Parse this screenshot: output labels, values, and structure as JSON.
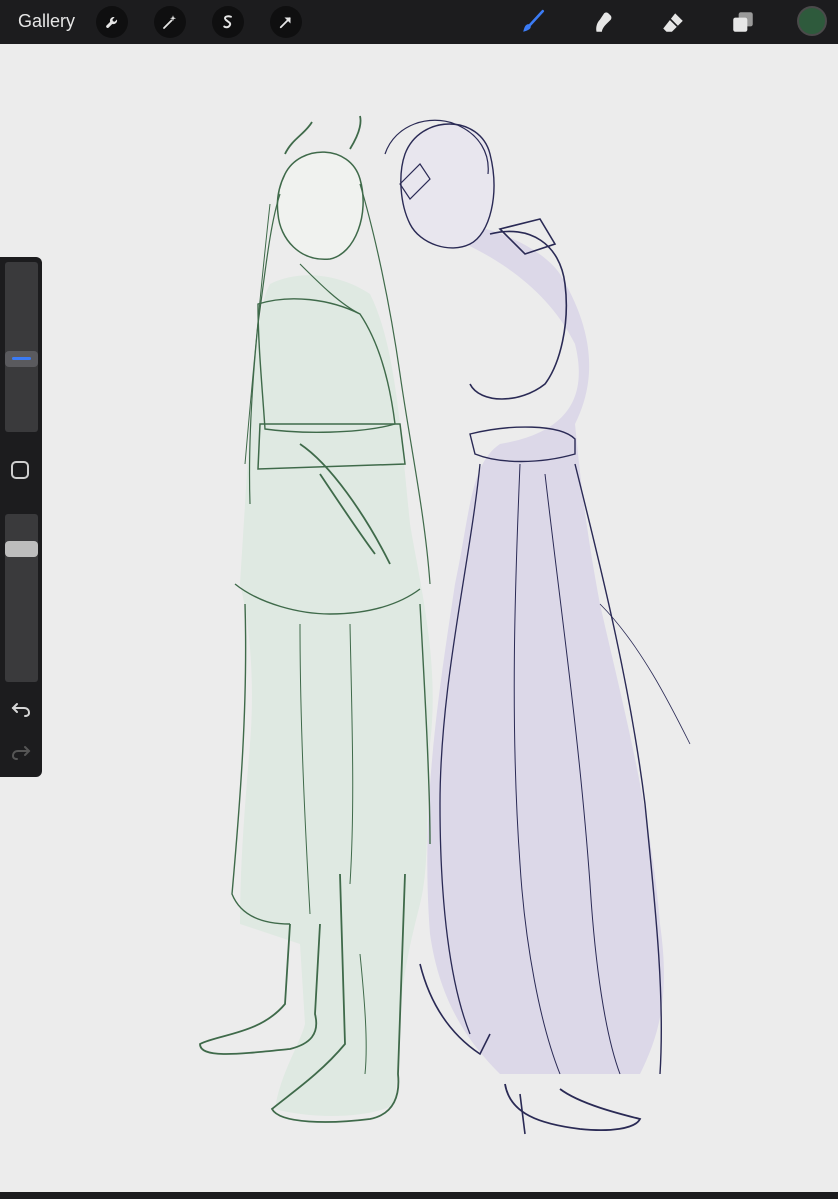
{
  "toolbar": {
    "gallery_label": "Gallery",
    "left_tools": [
      "wrench-icon",
      "magic-wand-icon",
      "selection-icon",
      "transform-arrow-icon"
    ],
    "right_tools": [
      "brush-icon",
      "smudge-icon",
      "eraser-icon",
      "layers-icon"
    ],
    "active_tool": "brush-icon",
    "accent_color": "#3b7bf5",
    "current_color": "#2e5a3c"
  },
  "sidebar": {
    "brush_size_level": 0.42,
    "opacity_level": 0.82,
    "undo_icon": "undo-icon",
    "redo_icon": "redo-icon"
  },
  "canvas": {
    "background": "#ececec",
    "sketch_colors": {
      "left_figure": "#3f6a4a",
      "left_fill": "#dfe9e2",
      "right_figure": "#2a2a55",
      "right_fill": "#dcd8e8"
    }
  }
}
